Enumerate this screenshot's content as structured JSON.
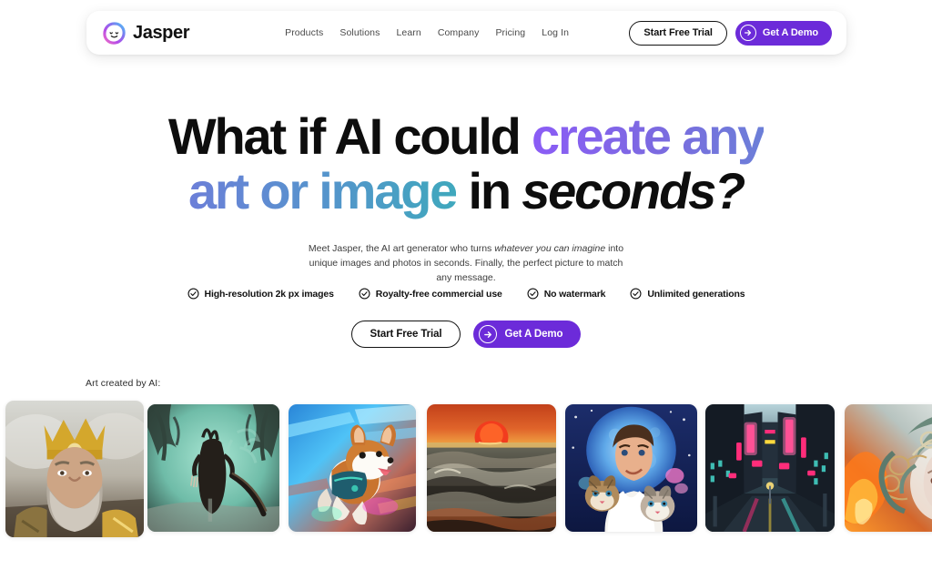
{
  "brand": {
    "name": "Jasper",
    "logo_icon": "jasper-smiley-gradient-ring-icon"
  },
  "nav": {
    "links": [
      {
        "label": "Products"
      },
      {
        "label": "Solutions"
      },
      {
        "label": "Learn"
      },
      {
        "label": "Company"
      },
      {
        "label": "Pricing"
      },
      {
        "label": "Log In"
      }
    ]
  },
  "header_actions": {
    "trial_label": "Start Free Trial",
    "demo_label": "Get A Demo",
    "demo_icon": "arrow-right-circle-icon"
  },
  "hero": {
    "line1_plain": "What if AI could ",
    "line1_gradient": "create any",
    "line2_gradient": "art or image",
    "line2_plain": " in ",
    "line2_italic": "seconds?",
    "subcopy_part1": "Meet Jasper, the AI art generator who turns ",
    "subcopy_italic": "whatever you can imagine",
    "subcopy_part2": " into unique images and photos in seconds. Finally, the perfect picture to match any message."
  },
  "features": [
    {
      "label": "High-resolution 2k px images",
      "icon": "check-circle-icon"
    },
    {
      "label": "Royalty-free commercial use",
      "icon": "check-circle-icon"
    },
    {
      "label": "No watermark",
      "icon": "check-circle-icon"
    },
    {
      "label": "Unlimited generations",
      "icon": "check-circle-icon"
    }
  ],
  "cta": {
    "trial_label": "Start Free Trial",
    "demo_label": "Get A Demo",
    "demo_icon": "arrow-right-circle-icon"
  },
  "gallery": {
    "label": "Art created by AI:",
    "items": [
      {
        "alt": "Bearded king wearing a golden crown with gold armor in misty battlefield"
      },
      {
        "alt": "Dark horned creature holding a long blade in a haunted teal forest"
      },
      {
        "alt": "Corgi dog in a harness leaping through neon-lit motion blur"
      },
      {
        "alt": "Red sun setting over dramatic dark ocean waves"
      },
      {
        "alt": "Smiling man holding two tabby kittens in front of a blue moon"
      },
      {
        "alt": "Rainy cyberpunk city street with pink and teal neon signs"
      },
      {
        "alt": "Celtic warrior woman in ornate green helmet with fire behind"
      }
    ]
  },
  "colors": {
    "accent_purple": "#6C2BD9",
    "gradient_purple": "#8B5CF6",
    "gradient_blue": "#6C7FD8",
    "gradient_teal": "#3FA8BD",
    "text_dark": "#0D0D0D",
    "background": "#FFFFFF"
  }
}
